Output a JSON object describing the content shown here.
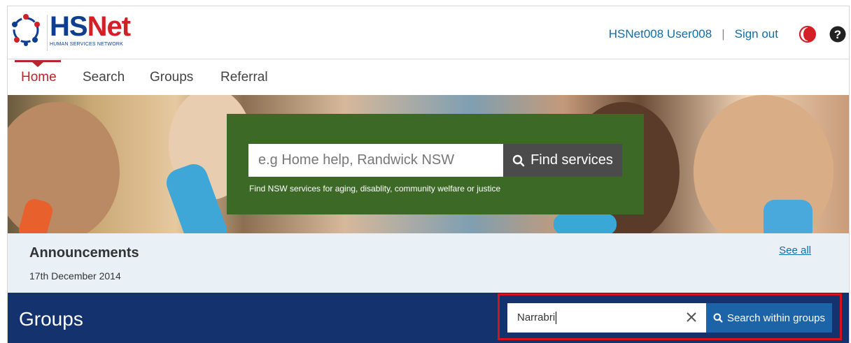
{
  "brand": {
    "name_part1": "HS",
    "name_part2": "Net",
    "subtitle": "HUMAN SERVICES NETWORK",
    "color_primary": "#0e3e8f",
    "color_accent": "#d32027"
  },
  "header": {
    "user_name": "HSNet008 User008",
    "separator": "|",
    "sign_out": "Sign out",
    "icons": [
      "contrast-icon",
      "help-icon"
    ]
  },
  "nav": {
    "items": [
      {
        "label": "Home",
        "active": true
      },
      {
        "label": "Search",
        "active": false
      },
      {
        "label": "Groups",
        "active": false
      },
      {
        "label": "Referral",
        "active": false
      }
    ]
  },
  "hero": {
    "search_placeholder": "e.g Home help, Randwick NSW",
    "find_button": "Find services",
    "hint": "Find NSW services for aging, disablity, community welfare or justice"
  },
  "announcements": {
    "title": "Announcements",
    "date": "17th December 2014",
    "see_all": "See all"
  },
  "groups": {
    "title": "Groups",
    "search_value": "Narrabri",
    "search_button": "Search within groups",
    "highlight_color": "#d6121c"
  }
}
